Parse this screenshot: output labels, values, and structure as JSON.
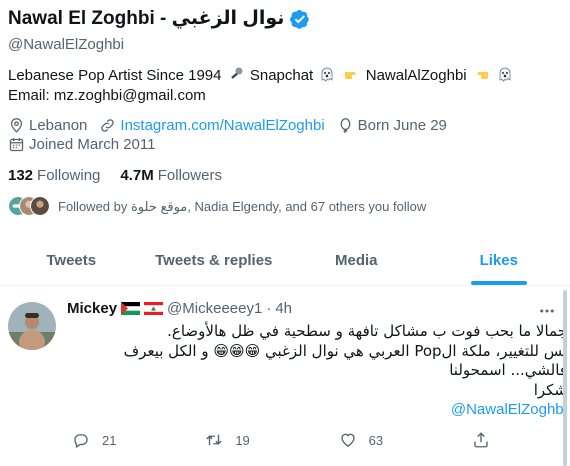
{
  "profile": {
    "name": "Nawal El Zoghbi - نوال الزغبي",
    "handle": "@NawalElZoghbi",
    "bio_part1": "Lebanese Pop Artist Since 1994",
    "bio_part2": "Snapchat",
    "bio_part3": "NawalAlZoghbi",
    "bio_part4": "Email:",
    "bio_email": "mz.zoghbi@gmail.com",
    "location": "Lebanon",
    "website": "Instagram.com/NawalElZoghbi",
    "birthday": "Born June 29",
    "joined": "Joined March 2011",
    "following_count": "132",
    "following_label": "Following",
    "followers_count": "4.7M",
    "followers_label": "Followers",
    "followed_by": "Followed by موقع حلوة, Nadia Elgendy, and 67 others you follow"
  },
  "tabs": [
    {
      "label": "Tweets"
    },
    {
      "label": "Tweets & replies"
    },
    {
      "label": "Media"
    },
    {
      "label": "Likes"
    }
  ],
  "tweet": {
    "name": "Mickey",
    "handle": "@Mickeeeey1",
    "dot": "·",
    "time": "4h",
    "line1": "جمالا ما بحب فوت ب مشاكل تافهة و سطحية في ظل هالأوضاع.",
    "line2": "بس للتغيير،  ملكة الPop العربي هي نوال الزغبي 😁😁😁 و الكل بيعرف",
    "line3": "فالشي... اسمحولنا",
    "line4": "شكرا",
    "mention": "@NawalElZoghbi",
    "replies": "21",
    "retweets": "19",
    "likes": "63"
  },
  "colors": {
    "accent": "#1d9bf0",
    "muted": "#536471",
    "text": "#0f1419"
  }
}
